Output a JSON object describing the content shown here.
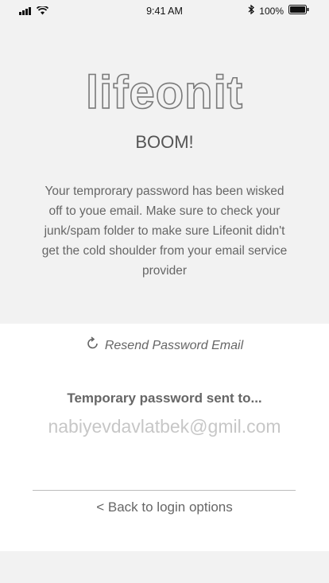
{
  "status_bar": {
    "time": "9:41 AM",
    "battery_percent": "100%",
    "icons": [
      "signal-icon",
      "wifi-icon",
      "bluetooth-icon",
      "battery-icon"
    ]
  },
  "hero": {
    "logo": "lifeonit",
    "headline": "BOOM!",
    "message": "Your temprorary password has been wisked off to youe email. Make sure to check your junk/spam folder to make sure Lifeonit didn't get the cold shoulder from your email service provider"
  },
  "panel": {
    "resend_label": "Resend Password Email",
    "sent_label": "Temporary password sent to...",
    "email_value": "nabiyevdavlatbek@gmil.com",
    "back_label": "< Back to login options"
  }
}
